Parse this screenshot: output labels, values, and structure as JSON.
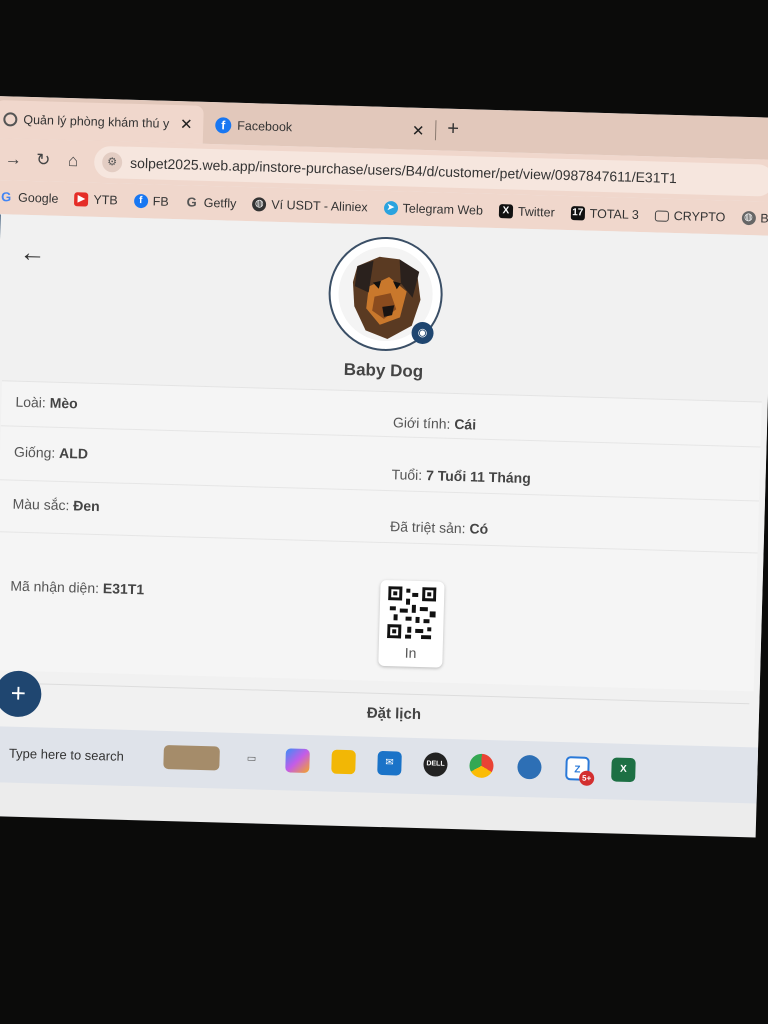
{
  "tabs": [
    {
      "title": "Quản lý phòng khám thú y",
      "close": "✕"
    },
    {
      "title": "Facebook",
      "close": "✕"
    }
  ],
  "new_tab": "+",
  "address": {
    "url": "solpet2025.web.app/instore-purchase/users/B4/d/customer/pet/view/0987847611/E31T1"
  },
  "bookmarks": [
    "Google",
    "YTB",
    "FB",
    "Getfly",
    "Ví USDT - Aliniex",
    "Telegram Web",
    "Twitter",
    "TOTAL 3",
    "CRYPTO",
    "Bi"
  ],
  "pet": {
    "name": "Baby Dog",
    "species_label": "Loài:",
    "species": "Mèo",
    "gender_label": "Giới tính:",
    "gender": "Cái",
    "breed_label": "Giống:",
    "breed": "ALD",
    "age_label": "Tuổi:",
    "age": "7 Tuổi 11 Tháng",
    "color_label": "Màu sắc:",
    "color": "Đen",
    "neutered_label": "Đã triệt sản:",
    "neutered": "Có",
    "id_label": "Mã nhận diện:",
    "id": "E31T1"
  },
  "qr": {
    "print_label": "In"
  },
  "actions": {
    "fab": "+",
    "book": "Đặt lịch"
  },
  "taskbar": {
    "search_placeholder": "Type here to search",
    "mail_badge": "5+"
  },
  "colors": {
    "primary": "#1f4670",
    "tab_bg": "#f0d7cc"
  }
}
